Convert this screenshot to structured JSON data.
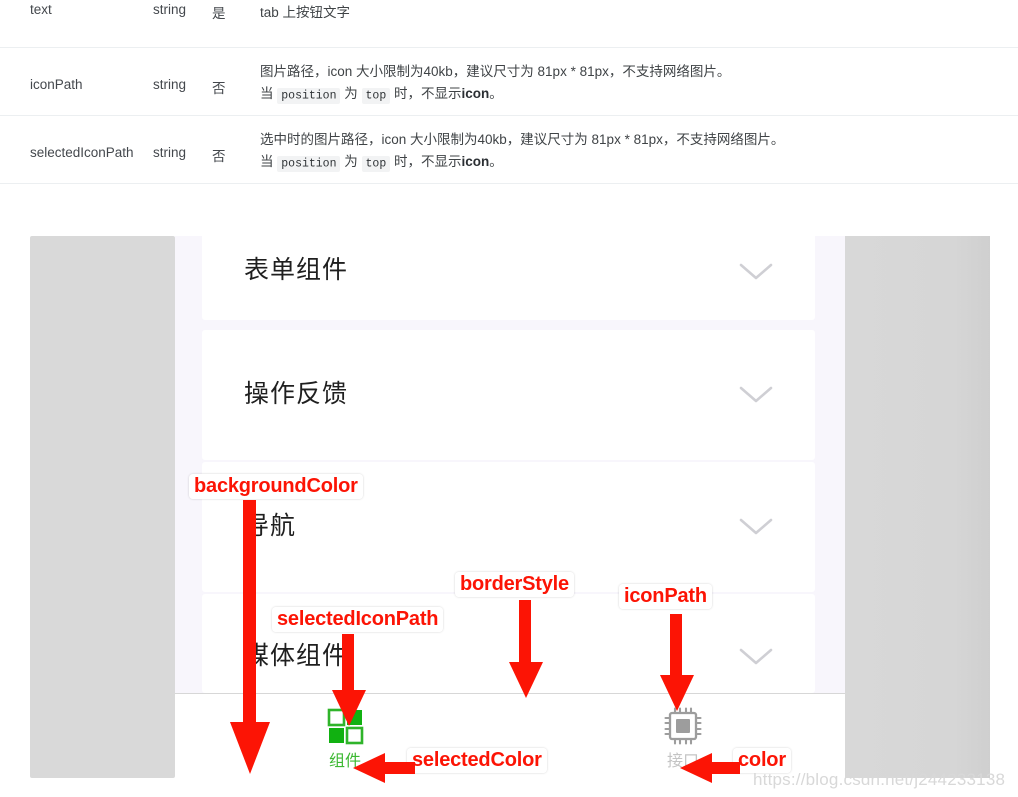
{
  "api_table": {
    "rows": [
      {
        "name": "text",
        "type": "string",
        "required": "是",
        "desc_line1": "tab 上按钮文字",
        "desc_line2": ""
      },
      {
        "name": "iconPath",
        "type": "string",
        "required": "否",
        "desc_line1_a": "图片路径，icon 大小限制为40kb，建议尺寸为 81px * 81px，不支持网络图片。",
        "desc_prefix": "当",
        "desc_code1": "position",
        "desc_mid": "为",
        "desc_code2": "top",
        "desc_suffix": "时，不显示",
        "desc_bold": "icon",
        "desc_end": "。"
      },
      {
        "name": "selectedIconPath",
        "type": "string",
        "required": "否",
        "desc_line1_a": "选中时的图片路径，icon 大小限制为40kb，建议尺寸为 81px * 81px，不支持网络图片。",
        "desc_prefix": "当",
        "desc_code1": "position",
        "desc_mid": "为",
        "desc_code2": "top",
        "desc_suffix": "时，不显示",
        "desc_bold": "icon",
        "desc_end": "。"
      }
    ]
  },
  "mockup": {
    "cards": [
      {
        "title": "表单组件"
      },
      {
        "title": "操作反馈"
      },
      {
        "title": "导航"
      },
      {
        "title": "媒体组件"
      }
    ],
    "tabbar": {
      "items": [
        {
          "label": "组件",
          "color": "#3cb832",
          "icon": "grid-icon",
          "state": "selected"
        },
        {
          "label": "接口",
          "color": "#bfbfbf",
          "icon": "chip-icon",
          "state": "normal"
        }
      ]
    },
    "annotations": [
      {
        "label": "backgroundColor"
      },
      {
        "label": "selectedIconPath"
      },
      {
        "label": "borderStyle"
      },
      {
        "label": "iconPath"
      },
      {
        "label": "selectedColor"
      },
      {
        "label": "color"
      }
    ]
  },
  "watermark": "https://blog.csdn.net/j244233138",
  "colors": {
    "annotation_red": "#fc1405",
    "selected_green": "#3cb832",
    "normal_gray": "#bfbfbf",
    "page_bg": "#f8f6fc"
  }
}
